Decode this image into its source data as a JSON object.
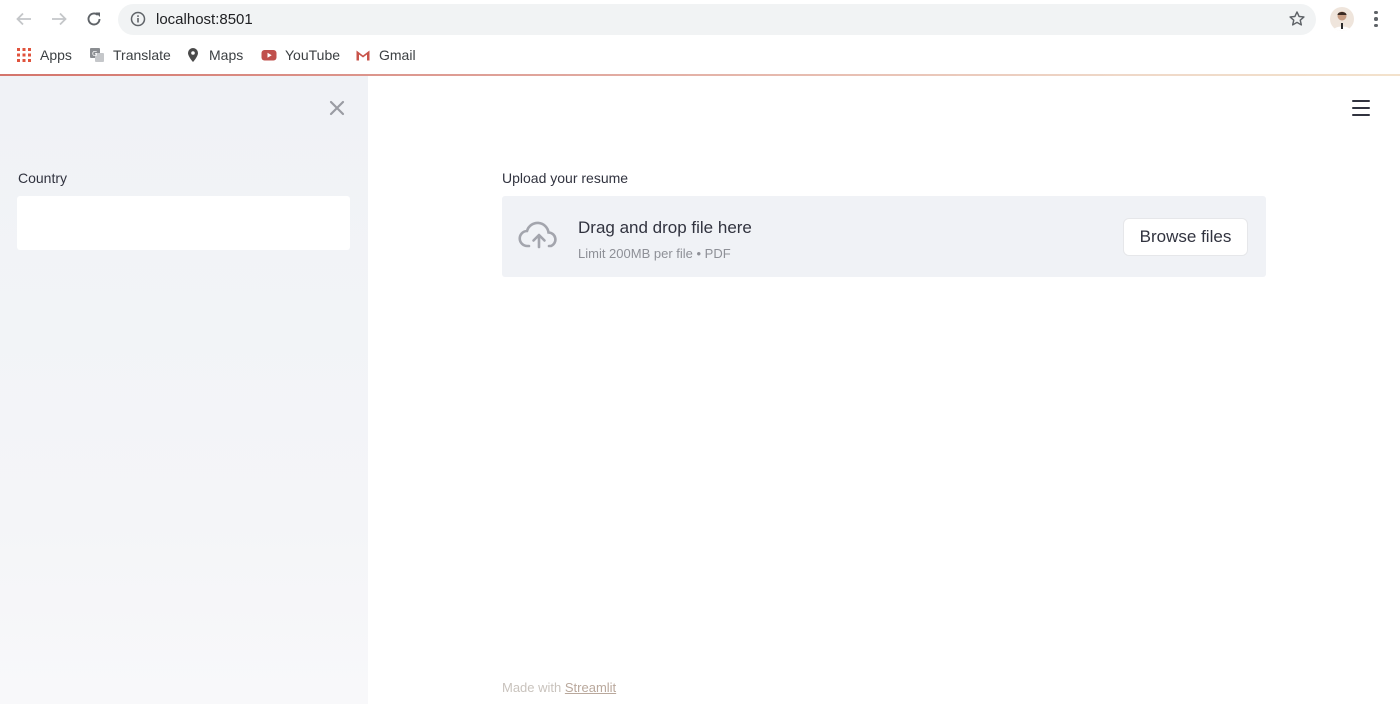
{
  "browser": {
    "url": "localhost:8501",
    "bookmarks": [
      {
        "label": "Apps",
        "icon": "apps-grid-icon"
      },
      {
        "label": "Translate",
        "icon": "translate-icon"
      },
      {
        "label": "Maps",
        "icon": "maps-pin-icon"
      },
      {
        "label": "YouTube",
        "icon": "youtube-icon"
      },
      {
        "label": "Gmail",
        "icon": "gmail-icon"
      }
    ]
  },
  "sidebar": {
    "close_icon": "close-icon",
    "country_label": "Country",
    "country_value": ""
  },
  "main": {
    "menu_icon": "hamburger-menu-icon",
    "upload_label": "Upload your resume",
    "dropzone_title": "Drag and drop file here",
    "dropzone_limit": "Limit 200MB per file • PDF",
    "browse_label": "Browse files",
    "footer_prefix": "Made with ",
    "footer_link": "Streamlit"
  },
  "colors": {
    "sidebar_bg": "#f0f2f6",
    "text": "#31333f",
    "accent_line": "#d4746b"
  }
}
